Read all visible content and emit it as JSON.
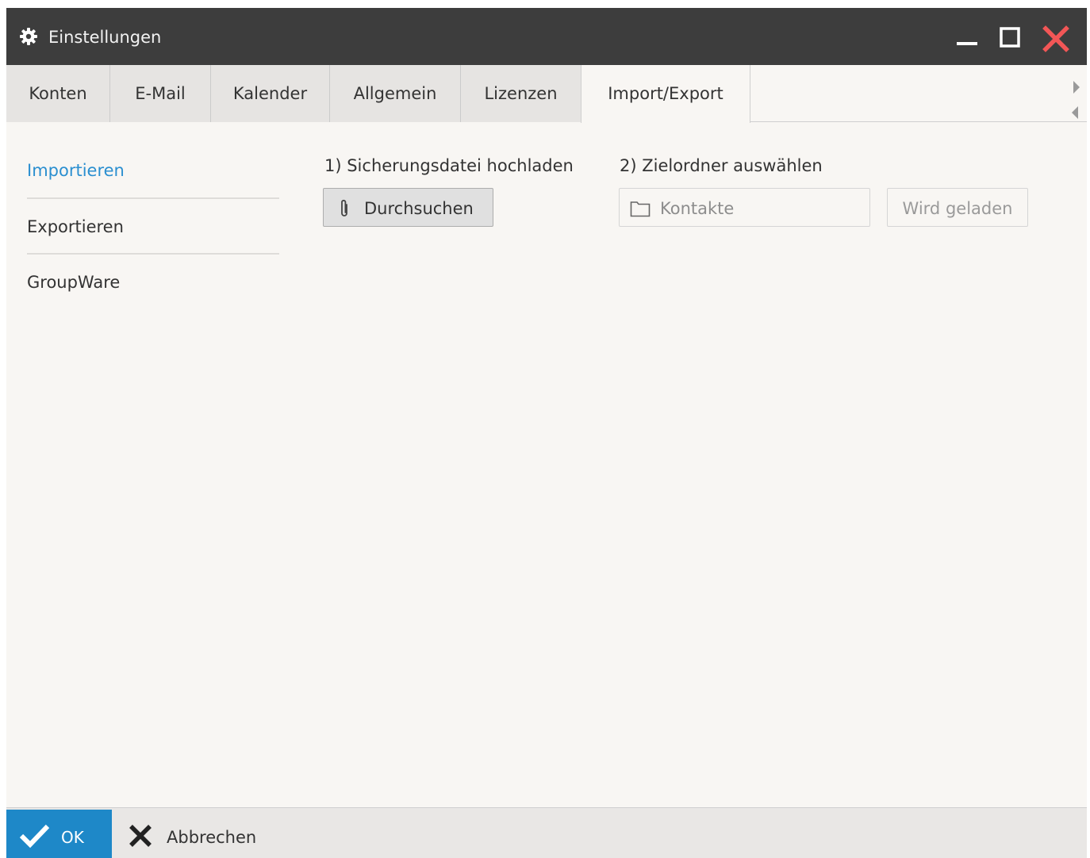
{
  "window": {
    "title": "Einstellungen",
    "icons": {
      "settings": "gear-icon",
      "minimize": "minimize-icon",
      "maximize": "maximize-icon",
      "close": "close-icon"
    },
    "colors": {
      "titlebar": "#3d3d3d",
      "close": "#f25656",
      "accent": "#2b8fd0",
      "ok_button": "#1e88c8"
    }
  },
  "tabs": [
    {
      "label": "Konten"
    },
    {
      "label": "E-Mail"
    },
    {
      "label": "Kalender"
    },
    {
      "label": "Allgemein"
    },
    {
      "label": "Lizenzen"
    },
    {
      "label": "Import/Export",
      "active": true
    }
  ],
  "sidebar": {
    "items": [
      {
        "label": "Importieren",
        "active": true
      },
      {
        "label": "Exportieren"
      },
      {
        "label": "GroupWare"
      }
    ]
  },
  "import": {
    "step1_label": "1) Sicherungsdatei hochladen",
    "browse_label": "Durchsuchen",
    "step2_label": "2) Zielordner auswählen",
    "folder_value": "Kontakte",
    "loading_label": "Wird geladen"
  },
  "footer": {
    "ok_label": "OK",
    "cancel_label": "Abbrechen"
  }
}
